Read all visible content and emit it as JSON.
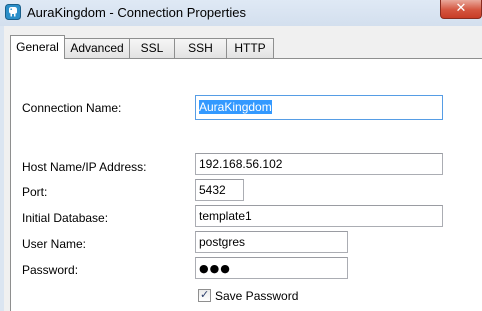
{
  "window": {
    "title": "AuraKingdom - Connection Properties",
    "close_glyph": "✕",
    "app_icon": "elephant-app-icon"
  },
  "tabs": [
    {
      "label": "General",
      "active": true
    },
    {
      "label": "Advanced",
      "active": false
    },
    {
      "label": "SSL",
      "active": false
    },
    {
      "label": "SSH",
      "active": false
    },
    {
      "label": "HTTP",
      "active": false
    }
  ],
  "form": {
    "connection_name": {
      "label": "Connection Name:",
      "value": "AuraKingdom"
    },
    "host": {
      "label": "Host Name/IP Address:",
      "value": "192.168.56.102"
    },
    "port": {
      "label": "Port:",
      "value": "5432"
    },
    "database": {
      "label": "Initial Database:",
      "value": "template1"
    },
    "user": {
      "label": "User Name:",
      "value": "postgres"
    },
    "password": {
      "label": "Password:",
      "value": "●●●"
    },
    "save_password": {
      "label": "Save Password",
      "checked": true,
      "mark": "✓"
    }
  },
  "colors": {
    "selection": "#3399ff",
    "focus_border": "#569de5",
    "title_bar": "#d3dfee",
    "close_button": "#c83c26"
  }
}
